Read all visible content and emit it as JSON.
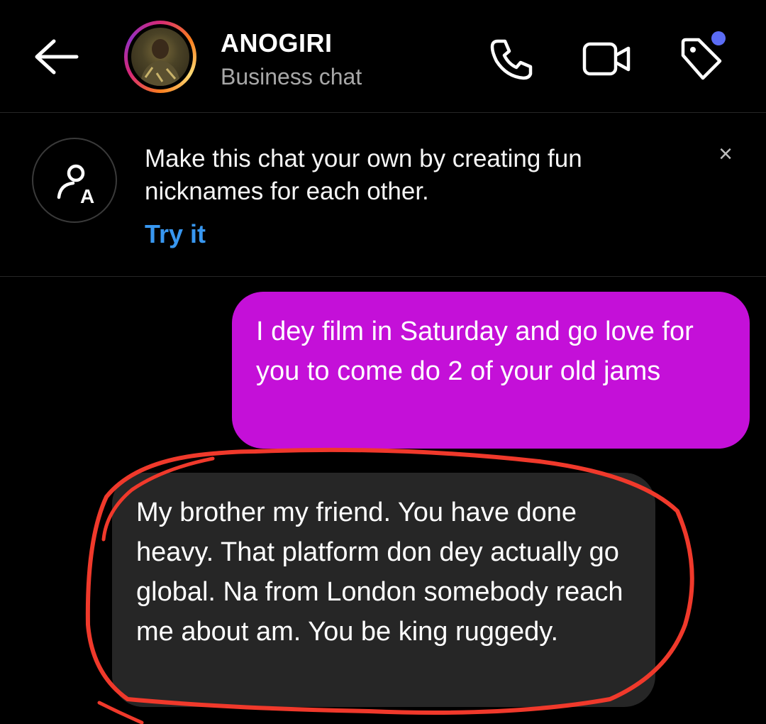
{
  "header": {
    "contact_name": "ANOGIRI",
    "contact_subtitle": "Business chat",
    "icons": [
      "back-arrow-icon",
      "phone-icon",
      "video-camera-icon",
      "tag-icon"
    ],
    "notification_dot_color": "#5b6cf5"
  },
  "banner": {
    "text": "Make this chat your own by creating fun nicknames for each other.",
    "link": "Try it",
    "close": "×"
  },
  "messages": [
    {
      "direction": "outgoing",
      "text": "I dey film in Saturday and go love for you to come do 2 of your old jams",
      "color": "#c410d8"
    },
    {
      "direction": "incoming",
      "text": "My brother my friend. You have done heavy. That platform don dey actually go global. Na from London somebody reach me about am. You be king ruggedy.",
      "color": "#262626"
    }
  ],
  "annotation": {
    "color": "#f0392b",
    "shape": "hand-drawn circle"
  }
}
